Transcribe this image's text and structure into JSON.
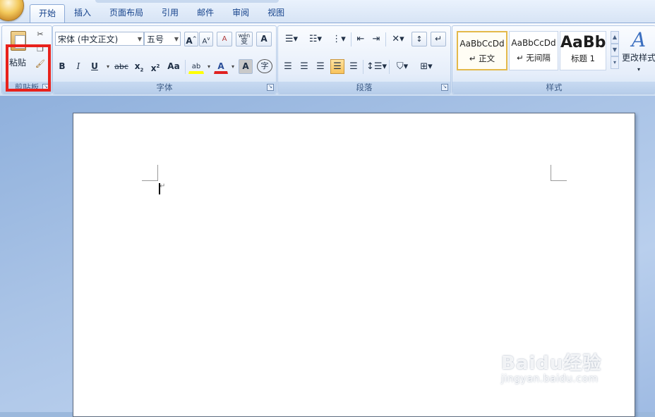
{
  "tabs": [
    "开始",
    "插入",
    "页面布局",
    "引用",
    "邮件",
    "审阅",
    "视图"
  ],
  "active_tab": 0,
  "clipboard": {
    "paste_label": "粘贴",
    "group_label": "剪贴板"
  },
  "font": {
    "font_name": "宋体 (中文正文)",
    "font_size": "五号",
    "group_label": "字体",
    "grow": "A",
    "shrink": "A",
    "clear": "A",
    "phonetic": "wén",
    "phonetic_char": "变",
    "border_char": "A",
    "bold": "B",
    "italic": "I",
    "underline": "U",
    "strike": "abc",
    "subscript": "x",
    "superscript": "x",
    "change_case": "Aa",
    "highlight": "ab",
    "font_color": "A",
    "shading_char": "A",
    "enclose_char": "字"
  },
  "paragraph": {
    "group_label": "段落"
  },
  "styles": {
    "group_label": "样式",
    "items": [
      {
        "sample": "AaBbCcDd",
        "name": "↵ 正文"
      },
      {
        "sample": "AaBbCcDd",
        "name": "↵ 无间隔"
      },
      {
        "sample": "AaBb",
        "name": "标题 1"
      }
    ],
    "change_label": "更改样式"
  },
  "watermark": {
    "main": "Baidu经验",
    "sub": "jingyan.baidu.com"
  },
  "colors": {
    "highlight_box": "#e8221c",
    "tab_text": "#15428b",
    "page_bg": "#ffffff"
  }
}
